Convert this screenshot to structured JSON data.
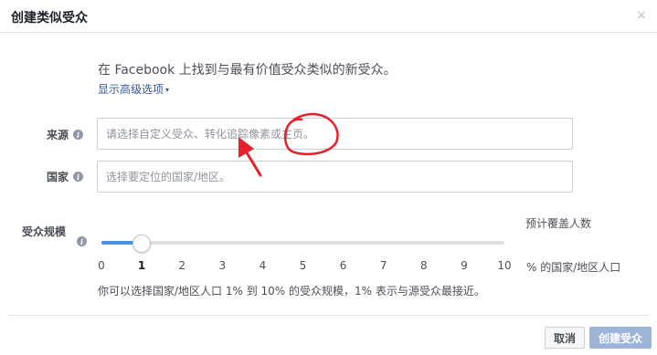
{
  "dialog": {
    "title": "创建类似受众",
    "close_glyph": "×"
  },
  "intro": {
    "text": "在 Facebook 上找到与最有价值受众类似的新受众。",
    "advanced_link": "显示高级选项",
    "advanced_caret": "▾"
  },
  "source": {
    "label": "来源",
    "placeholder": "请选择自定义受众、转化追踪像素或主页。"
  },
  "country": {
    "label": "国家",
    "placeholder": "选择要定位的国家/地区。"
  },
  "size": {
    "label": "受众规模",
    "estimate_label": "预计覆盖人数",
    "selected_value": 1,
    "min": 0,
    "max": 10,
    "ticks": [
      "0",
      "1",
      "2",
      "3",
      "4",
      "5",
      "6",
      "7",
      "8",
      "9",
      "10"
    ],
    "unit_label": "% 的国家/地区人口",
    "note": "你可以选择国家/地区人口 1% 到 10% 的受众规模，1% 表示与源受众最接近。"
  },
  "footer": {
    "cancel_label": "取消",
    "create_label": "创建受众"
  },
  "colors": {
    "accent": "#4a90e2",
    "link": "#365899",
    "create_button_disabled": "#9cb4d8",
    "annotation": "#e8202a"
  },
  "icons": {
    "info": "info-icon",
    "close": "close-icon",
    "caret": "caret-down-icon"
  }
}
